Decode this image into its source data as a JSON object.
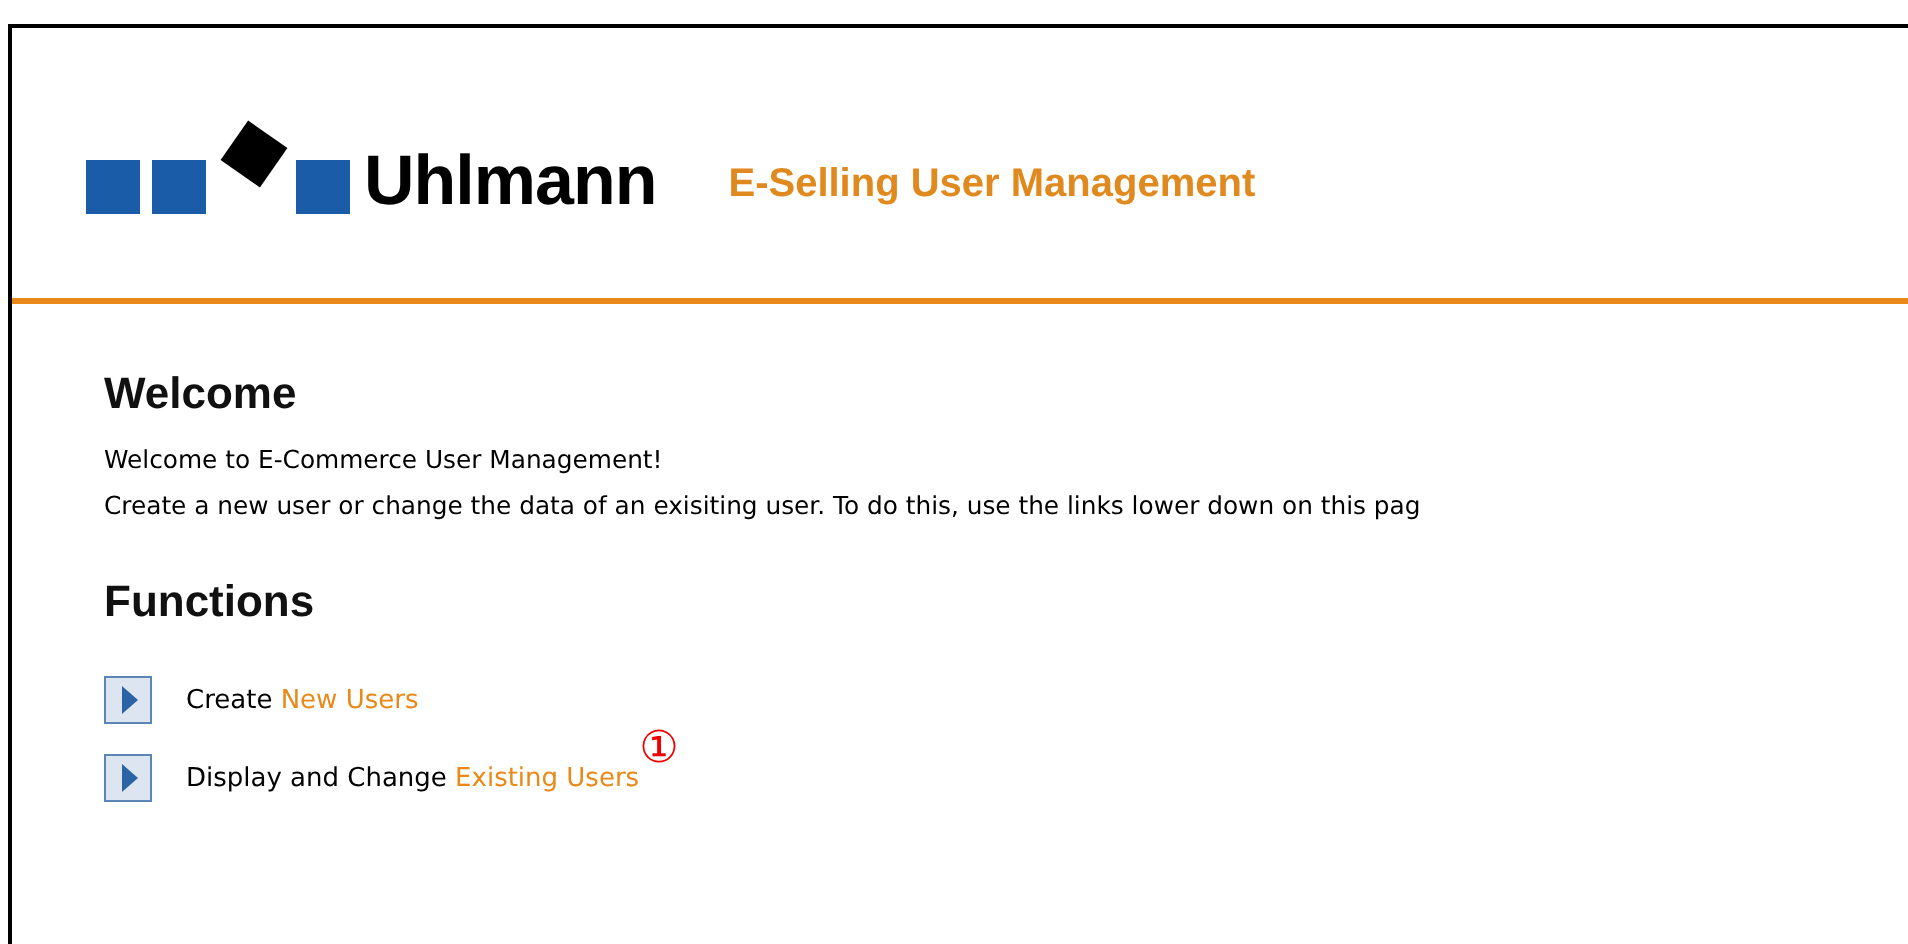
{
  "header": {
    "logo_text": "Uhlmann",
    "title": "E-Selling User Management"
  },
  "welcome": {
    "heading": "Welcome",
    "lines": [
      "Welcome to E-Commerce User Management!",
      "Create a new user or change the data of an exisiting user. To do this, use the links lower down on this pag"
    ]
  },
  "functions": {
    "heading": "Functions",
    "items": [
      {
        "text": "Create ",
        "link": "New Users"
      },
      {
        "text": "Display and Change ",
        "link": "Existing Users",
        "callout": "①"
      }
    ]
  }
}
